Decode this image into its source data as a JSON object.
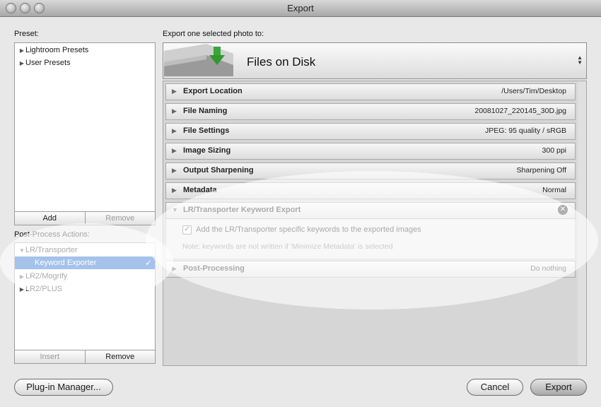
{
  "window": {
    "title": "Export"
  },
  "preset": {
    "label": "Preset:",
    "items": [
      "Lightroom Presets",
      "User Presets"
    ],
    "add_label": "Add",
    "remove_label": "Remove"
  },
  "post_process": {
    "label": "Post-Process Actions:",
    "items": [
      {
        "label": "LR/Transporter",
        "expanded": true
      },
      {
        "label": "Keyword Exporter",
        "selected": true,
        "check": "✓"
      },
      {
        "label": "LR2/Mogrify",
        "expanded": false
      },
      {
        "label": "LR2/PLUS",
        "expanded": false
      }
    ],
    "insert_label": "Insert",
    "remove_label": "Remove"
  },
  "export_to": {
    "label": "Export one selected photo to:",
    "destination": "Files on Disk"
  },
  "sections": [
    {
      "name": "Export Location",
      "value": "/Users/Tim/Desktop"
    },
    {
      "name": "File Naming",
      "value": "20081027_220145_30D.jpg"
    },
    {
      "name": "File Settings",
      "value": "JPEG: 95 quality / sRGB"
    },
    {
      "name": "Image Sizing",
      "value": "300 ppi"
    },
    {
      "name": "Output Sharpening",
      "value": "Sharpening Off"
    },
    {
      "name": "Metadata",
      "value": "Normal"
    }
  ],
  "keyword_section": {
    "name": "LR/Transporter Keyword Export",
    "checkbox_label": "Add the LR/Transporter specific keywords to the exported images",
    "checked": true,
    "note": "Note: keywords are not written if 'Minimize Metadata' is selected"
  },
  "post_processing": {
    "name": "Post-Processing",
    "value": "Do nothing"
  },
  "buttons": {
    "plugin_manager": "Plug-in Manager...",
    "cancel": "Cancel",
    "export": "Export"
  }
}
